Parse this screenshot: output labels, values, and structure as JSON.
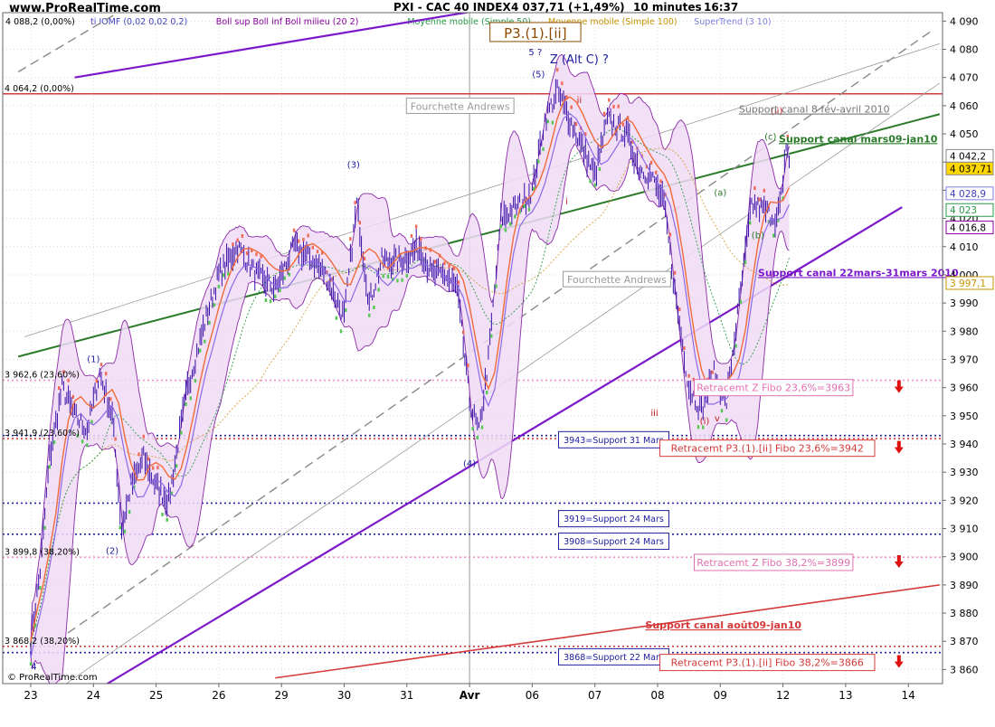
{
  "header": {
    "site": "www.ProRealTime.com",
    "instrument": "PXI - CAC 40 INDEX",
    "last": "4 037,71 (+1,49%)",
    "interval": "10 minutes",
    "time": "16:37",
    "legend": [
      {
        "text": "4 088,2 (0,00%)",
        "color": "#000000"
      },
      {
        "text": "ti IOMF (0,02 0,02 0,2)",
        "color": "#4040c0"
      },
      {
        "text": "Boll sup Boll inf Boll milieu (20 2)",
        "color": "#8a00a0"
      },
      {
        "text": "Moyenne mobile (Simple 50)",
        "color": "#2a9a4a"
      },
      {
        "text": "Moyenne mobile (Simple 100)",
        "color": "#c89400"
      },
      {
        "text": "SuperTrend (3 10)",
        "color": "#8080e0"
      }
    ]
  },
  "footer": {
    "copyright": "© ProRealTime.com"
  },
  "chart_data": {
    "type": "line",
    "title": "PXI - CAC 40 INDEX",
    "x_tick_labels": [
      "23",
      "24",
      "25",
      "26",
      "29",
      "30",
      "31",
      "Avr",
      "06",
      "07",
      "08",
      "09",
      "12",
      "13",
      "14"
    ],
    "y_ticks": [
      3860,
      3870,
      3880,
      3890,
      3900,
      3910,
      3920,
      3930,
      3940,
      3950,
      3960,
      3970,
      3980,
      3990,
      4000,
      4010,
      4020,
      4030,
      4040,
      4050,
      4060,
      4070,
      4080,
      4090
    ],
    "ylim": [
      3855,
      4093
    ],
    "xlim": [
      0,
      14.5
    ],
    "grid": true,
    "price_path": [
      [
        0.0,
        3870
      ],
      [
        0.15,
        3895
      ],
      [
        0.3,
        3935
      ],
      [
        0.5,
        3960
      ],
      [
        0.7,
        3950
      ],
      [
        0.9,
        3945
      ],
      [
        1.1,
        3965
      ],
      [
        1.3,
        3950
      ],
      [
        1.45,
        3910
      ],
      [
        1.6,
        3925
      ],
      [
        1.8,
        3935
      ],
      [
        2.0,
        3925
      ],
      [
        2.2,
        3920
      ],
      [
        2.5,
        3960
      ],
      [
        2.8,
        3985
      ],
      [
        3.0,
        4000
      ],
      [
        3.3,
        4010
      ],
      [
        3.6,
        4000
      ],
      [
        3.9,
        3995
      ],
      [
        4.2,
        4010
      ],
      [
        4.5,
        4005
      ],
      [
        4.7,
        4000
      ],
      [
        5.0,
        3985
      ],
      [
        5.2,
        4025
      ],
      [
        5.4,
        3990
      ],
      [
        5.6,
        4005
      ],
      [
        5.9,
        4005
      ],
      [
        6.2,
        4010
      ],
      [
        6.4,
        4000
      ],
      [
        6.6,
        4000
      ],
      [
        6.8,
        3995
      ],
      [
        7.0,
        3955
      ],
      [
        7.15,
        3944
      ],
      [
        7.3,
        3970
      ],
      [
        7.5,
        4020
      ],
      [
        7.8,
        4025
      ],
      [
        8.0,
        4030
      ],
      [
        8.2,
        4055
      ],
      [
        8.4,
        4065
      ],
      [
        8.6,
        4055
      ],
      [
        8.8,
        4045
      ],
      [
        9.0,
        4035
      ],
      [
        9.2,
        4055
      ],
      [
        9.5,
        4050
      ],
      [
        9.7,
        4038
      ],
      [
        9.9,
        4035
      ],
      [
        10.1,
        4025
      ],
      [
        10.3,
        3990
      ],
      [
        10.5,
        3960
      ],
      [
        10.7,
        3952
      ],
      [
        10.9,
        3965
      ],
      [
        11.1,
        3955
      ],
      [
        11.3,
        3990
      ],
      [
        11.5,
        4025
      ],
      [
        11.7,
        4023
      ],
      [
        11.9,
        4020
      ],
      [
        12.0,
        4030
      ],
      [
        12.05,
        4047
      ],
      [
        12.12,
        4037.71
      ]
    ],
    "series": [
      {
        "color": "#7b18c9",
        "width": 2.2,
        "points": [
          [
            -0.2,
            3836
          ],
          [
            13.9,
            4024
          ]
        ]
      },
      {
        "color": "#7b18c9",
        "width": 2.2,
        "points": [
          [
            0.7,
            4070
          ],
          [
            11.0,
            4108
          ]
        ]
      },
      {
        "color": "#2a7a2a",
        "width": 2.0,
        "points": [
          [
            -0.2,
            3971
          ],
          [
            14.5,
            4057
          ]
        ]
      },
      {
        "color": "#d43a3a",
        "width": 1.6,
        "points": [
          [
            3.9,
            3857
          ],
          [
            14.5,
            3890
          ]
        ]
      },
      {
        "color": "#888888",
        "width": 1.4,
        "dash": "10,6",
        "points": [
          [
            0.4,
            3870
          ],
          [
            14.4,
            4087
          ]
        ]
      },
      {
        "color": "#888888",
        "width": 1.4,
        "dash": "10,6",
        "points": [
          [
            -0.2,
            4072
          ],
          [
            2.3,
            4105
          ]
        ]
      },
      {
        "color": "#999999",
        "width": 0.8,
        "points": [
          [
            -0.1,
            3978
          ],
          [
            14.5,
            4082
          ]
        ]
      },
      {
        "color": "#999999",
        "width": 0.8,
        "points": [
          [
            0.5,
            3854
          ],
          [
            14.5,
            4068
          ]
        ]
      }
    ],
    "levels": [
      {
        "value": 4064.2,
        "label": "4 064,2 (0,00%)",
        "color": "#d43a3a",
        "style": "solid",
        "label_color": "#000000"
      },
      {
        "value": 3962.6,
        "label": "3 962,6 (23,60%)",
        "color": "#f08cc8",
        "style": "dotted",
        "label_color": "#000000"
      },
      {
        "value": 3941.9,
        "label": "3 941,9 (23,60%)",
        "color": "#d43a3a",
        "style": "dotted",
        "label_color": "#000000"
      },
      {
        "value": 3899.8,
        "label": "3 899,8 (38,20%)",
        "color": "#f08cc8",
        "style": "dotted",
        "label_color": "#000000"
      },
      {
        "value": 3868.2,
        "label": "3 868,2 (38,20%)",
        "color": "#d43a3a",
        "style": "dotted",
        "label_color": "#000000"
      },
      {
        "value": 3943,
        "label": "",
        "color": "#2020a0",
        "style": "dotted",
        "label_color": "#000000"
      },
      {
        "value": 3919,
        "label": "",
        "color": "#2020a0",
        "style": "dotted",
        "label_color": "#000000"
      },
      {
        "value": 3908,
        "label": "",
        "color": "#2020a0",
        "style": "dotted",
        "label_color": "#000000"
      },
      {
        "value": 3866,
        "label": "",
        "color": "#2020a0",
        "style": "dotted",
        "label_color": "#000000"
      }
    ],
    "price_boxes": [
      {
        "value": 4042.2,
        "text": "4 042,2",
        "fill": "#ffffff",
        "stroke": "#888888",
        "color": "#000000"
      },
      {
        "value": 4037.71,
        "text": "4 037,71",
        "fill": "#ffd700",
        "stroke": "#888888",
        "color": "#000000"
      },
      {
        "value": 4028.9,
        "text": "4 028,9",
        "fill": "#ffffff",
        "stroke": "#8080e0",
        "color": "#4040c0"
      },
      {
        "value": 4023,
        "text": "4 023",
        "fill": "#ffffff",
        "stroke": "#2a9a4a",
        "color": "#2a9a4a"
      },
      {
        "value": 4016.8,
        "text": "4 016,8",
        "fill": "#ffffff",
        "stroke": "#8a00a0",
        "color": "#000000"
      },
      {
        "value": 3997.1,
        "text": "3 997,1",
        "fill": "#ffffff",
        "stroke": "#c89400",
        "color": "#c89400"
      }
    ],
    "wave_labels": [
      {
        "x": 1.0,
        "y": 3969,
        "text": "(1)",
        "color": "#2020a0"
      },
      {
        "x": 1.3,
        "y": 3901,
        "text": "(2)",
        "color": "#2020a0"
      },
      {
        "x": 5.15,
        "y": 4038,
        "text": "(3)",
        "color": "#2020a0"
      },
      {
        "x": 7.0,
        "y": 3932,
        "text": "(4)",
        "color": "#2020a0"
      },
      {
        "x": 8.1,
        "y": 4070,
        "text": "(5)",
        "color": "#2020a0"
      },
      {
        "x": 8.05,
        "y": 4078,
        "text": "5 ?",
        "color": "#2020a0"
      },
      {
        "x": 8.75,
        "y": 4061,
        "text": "ii",
        "color": "#c02020"
      },
      {
        "x": 8.55,
        "y": 4025,
        "text": "i",
        "color": "#c02020"
      },
      {
        "x": 9.95,
        "y": 3950,
        "text": "iii",
        "color": "#c02020"
      },
      {
        "x": 10.75,
        "y": 3947,
        "text": "(i)",
        "color": "#c02020"
      },
      {
        "x": 10.95,
        "y": 3948,
        "text": "v",
        "color": "#c02020"
      },
      {
        "x": 11.0,
        "y": 4028,
        "text": "(a)",
        "color": "#2a7a2a"
      },
      {
        "x": 11.6,
        "y": 4013,
        "text": "(b)",
        "color": "#2a7a2a"
      },
      {
        "x": 11.8,
        "y": 4048,
        "text": "(c)",
        "color": "#2a7a2a"
      },
      {
        "x": 11.9,
        "y": 4057,
        "text": "(ii)",
        "color": "#c02020"
      },
      {
        "x": 0.05,
        "y": 3860,
        "text": "4",
        "color": "#2020a0"
      }
    ],
    "annotations": [
      {
        "x": 8.05,
        "y": 4085,
        "text": "P3.(1).[ii]",
        "color": "#8b4a00",
        "boxed": true,
        "size": 15
      },
      {
        "x": 8.75,
        "y": 4076,
        "text": "Z (Alt C) ?",
        "color": "#2020a0",
        "size": 13
      },
      {
        "x": 6.85,
        "y": 4059.5,
        "text": "Fourchette Andrews",
        "color": "#9a9a9a",
        "boxed": true,
        "size": 11
      },
      {
        "x": 9.35,
        "y": 3998,
        "text": "Fourchette Andrews",
        "color": "#9a9a9a",
        "boxed": true,
        "size": 11
      },
      {
        "x": 12.5,
        "y": 4058.5,
        "text": "Support canal 8 fév-avril 2010",
        "color": "#777777",
        "size": 11,
        "underline": true
      },
      {
        "x": 13.2,
        "y": 4048,
        "text": "Support canal mars09-jan10",
        "color": "#2a7a2a",
        "size": 11,
        "underline": true,
        "bold": true
      },
      {
        "x": 13.2,
        "y": 4000.5,
        "text": "Support canal 22mars-31mars 2010",
        "color": "#7b18c9",
        "size": 11,
        "underline": true,
        "bold": true
      },
      {
        "x": 11.05,
        "y": 3875.5,
        "text": "Support canal août09-jan10",
        "color": "#d43a3a",
        "size": 11,
        "underline": true,
        "bold": true
      }
    ],
    "support_boxes": [
      {
        "x": 9.3,
        "y": 3941.5,
        "text": "3943=Support 31 Mars"
      },
      {
        "x": 9.3,
        "y": 3913.5,
        "text": "3919=Support 24 Mars"
      },
      {
        "x": 9.3,
        "y": 3905.5,
        "text": "3908=Support 24 Mars"
      },
      {
        "x": 9.3,
        "y": 3864.5,
        "text": "3868=Support 22 Mars"
      }
    ],
    "fibo_boxes": [
      {
        "x": 11.85,
        "y": 3960,
        "text": "Retracemt Z Fibo 23,6%=3963",
        "color": "#e070b0",
        "stroke": "#e070b0",
        "fill": "#ffffff"
      },
      {
        "x": 11.75,
        "y": 3938.5,
        "text": "Retracemt P3.(1).[ii] Fibo 23,6%=3942",
        "color": "#d43a3a",
        "stroke": "#d43a3a",
        "fill": "#ffffff"
      },
      {
        "x": 11.85,
        "y": 3898,
        "text": "Retracemt Z Fibo 38,2%=3899",
        "color": "#e070b0",
        "stroke": "#e070b0",
        "fill": "#ffffff"
      },
      {
        "x": 11.75,
        "y": 3862.5,
        "text": "Retracemt P3.(1).[ii] Fibo 38,2%=3866",
        "color": "#d43a3a",
        "stroke": "#d43a3a",
        "fill": "#ffffff"
      }
    ],
    "arrows": [
      {
        "x": 13.85,
        "y": 3960
      },
      {
        "x": 13.85,
        "y": 3938.5
      },
      {
        "x": 13.85,
        "y": 3898
      },
      {
        "x": 13.85,
        "y": 3862.5
      }
    ]
  }
}
